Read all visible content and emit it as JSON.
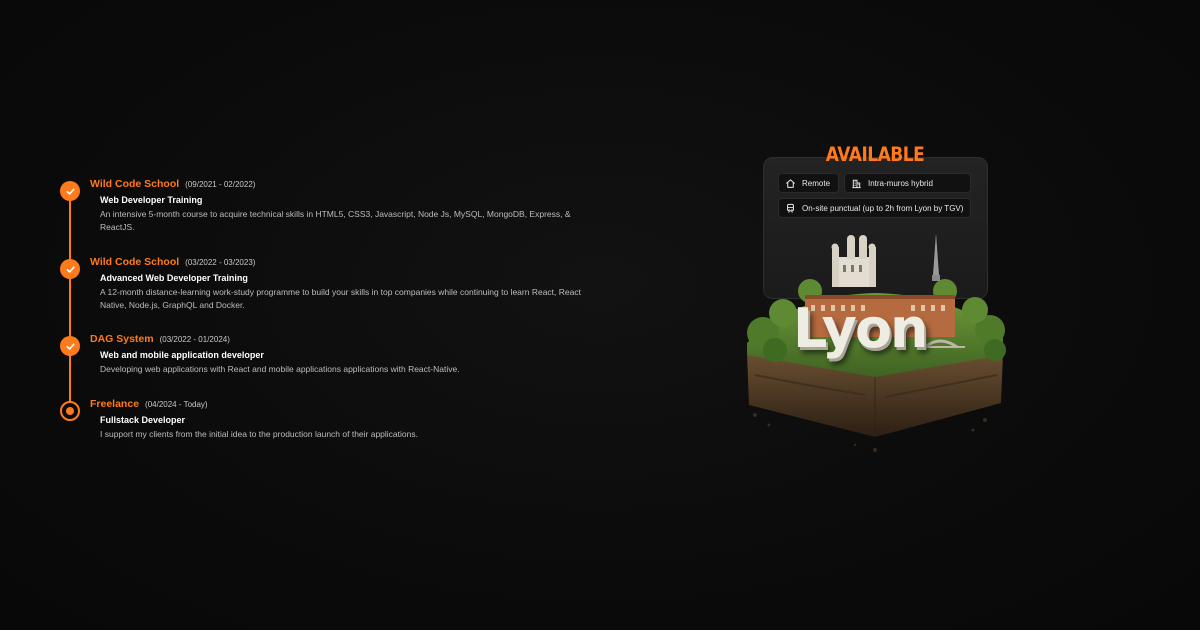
{
  "timeline": {
    "entries": [
      {
        "org": "Wild Code School",
        "dates": "(09/2021 - 02/2022)",
        "role": "Web Developer Training",
        "desc": "An intensive 5-month course to acquire technical skills in HTML5, CSS3, Javascript, Node Js, MySQL, MongoDB, Express, & ReactJS.",
        "status": "completed"
      },
      {
        "org": "Wild Code School",
        "dates": "(03/2022 - 03/2023)",
        "role": "Advanced Web Developer Training",
        "desc": "A 12-month distance-learning work-study programme to build your skills in top companies while continuing to learn React, React Native, Node.js, GraphQL and Docker.",
        "status": "completed"
      },
      {
        "org": "DAG System",
        "dates": "(03/2022 - 01/2024)",
        "role": "Web and mobile application developer",
        "desc": "Developing web applications with React and mobile applications applications with React-Native.",
        "status": "completed"
      },
      {
        "org": "Freelance",
        "dates": "(04/2024 - Today)",
        "role": "Fullstack Developer",
        "desc": "I support my clients from the initial idea to the production launch of their applications.",
        "status": "current"
      }
    ]
  },
  "availability": {
    "title": "AVAILABLE",
    "chips": {
      "remote": {
        "label": "Remote",
        "icon": "home-icon"
      },
      "hybrid": {
        "label": "Intra-muros hybrid",
        "icon": "building-icon"
      },
      "onsite": {
        "label": "On-site punctual (up to 2h from Lyon by TGV)",
        "icon": "train-icon"
      }
    }
  },
  "illustration": {
    "city": "Lyon"
  },
  "colors": {
    "accent": "#ff7a1a",
    "background": "#0b0b0b",
    "card": "#1f1f1f"
  }
}
